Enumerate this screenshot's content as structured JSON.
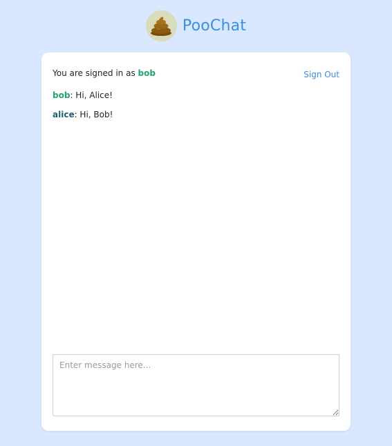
{
  "app": {
    "name": "PooChat",
    "logo_icon": "poop-emoji-icon"
  },
  "session": {
    "signed_in_prefix": "You are signed in as ",
    "username": "bob",
    "sign_out_label": "Sign Out"
  },
  "messages": [
    {
      "author": "bob",
      "text": ": Hi, Alice!"
    },
    {
      "author": "alice",
      "text": ": Hi, Bob!"
    }
  ],
  "composer": {
    "placeholder": "Enter message here..."
  },
  "colors": {
    "background": "#d9e8ff",
    "brand": "#3b8fe0",
    "self_author": "#20a56b",
    "other_author": "#1d5f73"
  }
}
